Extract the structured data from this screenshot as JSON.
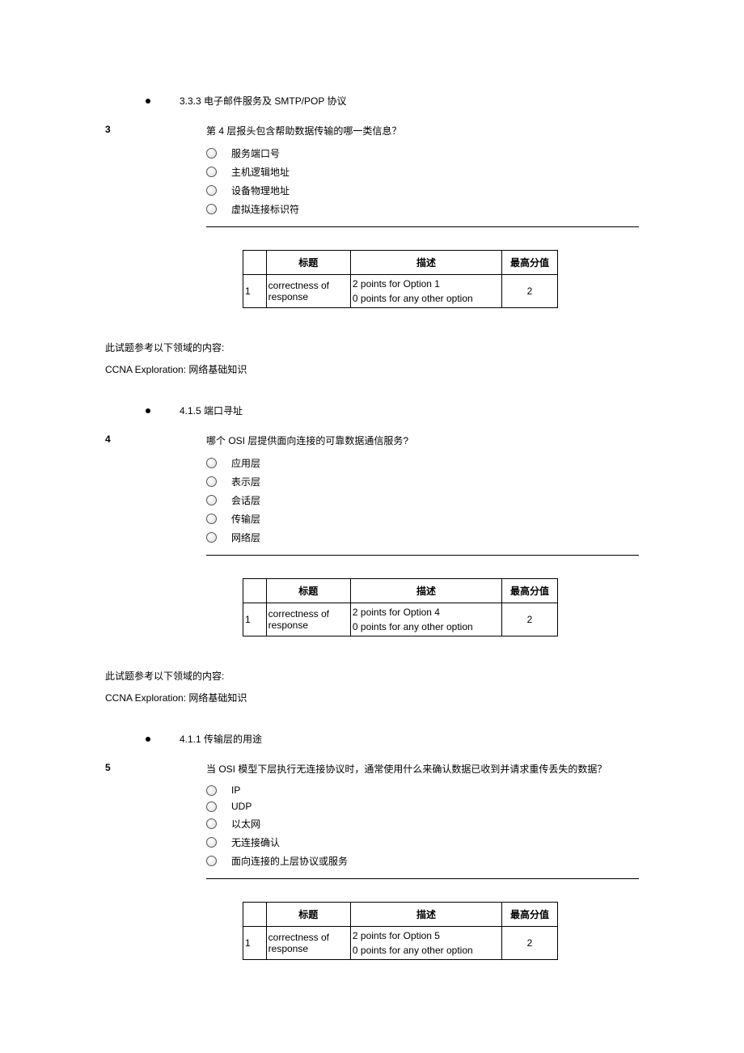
{
  "bullets": {
    "b1": "3.3.3 电子邮件服务及 SMTP/POP 协议",
    "b2": "4.1.5 端口寻址",
    "b3": "4.1.1 传输层的用途"
  },
  "table_headers": {
    "title": "标题",
    "desc": "描述",
    "max": "最高分值"
  },
  "ref": {
    "label": "此试题参考以下领域的内容:",
    "course": "CCNA Exploration: 网络基础知识"
  },
  "q3": {
    "num": "3",
    "text": "第 4 层报头包含帮助数据传输的哪一类信息？",
    "opts": [
      "服务端口号",
      "主机逻辑地址",
      "设备物理地址",
      "虚拟连接标识符"
    ],
    "score": {
      "idx": "1",
      "title": "correctness of response",
      "desc1": "2 points for Option 1",
      "desc2": "0 points for any other option",
      "max": "2"
    }
  },
  "q4": {
    "num": "4",
    "text": "哪个 OSI 层提供面向连接的可靠数据通信服务?",
    "opts": [
      "应用层",
      "表示层",
      "会话层",
      "传输层",
      "网络层"
    ],
    "score": {
      "idx": "1",
      "title": "correctness of response",
      "desc1": "2 points for Option 4",
      "desc2": "0 points for any other option",
      "max": "2"
    }
  },
  "q5": {
    "num": "5",
    "text": "当 OSI 模型下层执行无连接协议时，通常使用什么来确认数据已收到并请求重传丢失的数据？",
    "opts": [
      "IP",
      "UDP",
      "以太网",
      "无连接确认",
      "面向连接的上层协议或服务"
    ],
    "score": {
      "idx": "1",
      "title": "correctness of response",
      "desc1": "2 points for Option 5",
      "desc2": "0 points for any other option",
      "max": "2"
    }
  }
}
